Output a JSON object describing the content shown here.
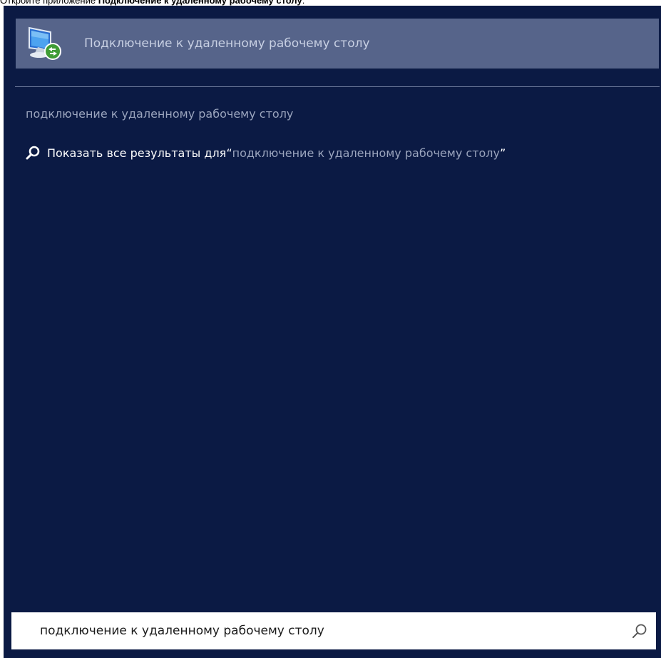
{
  "caption": {
    "prefix": "Откройте приложение ",
    "app_name": "Подключение к удаленному рабочему столу",
    "suffix": "."
  },
  "search_results": {
    "app_result": {
      "label": "Подключение к удаленному рабочему столу",
      "icon": "remote-desktop-icon"
    },
    "suggestion": "подключение к удаленному рабочему столу",
    "show_all": {
      "prefix": "Показать все результаты для ",
      "open_quote": "“",
      "query": "подключение к удаленному рабочему столу",
      "close_quote": "”",
      "icon": "search-icon"
    }
  },
  "search_box": {
    "value": "подключение к удаленному рабочему столу",
    "button_icon": "search-icon"
  },
  "colors": {
    "panel_bg": "#0b1a44",
    "highlight_bg": "#56648a",
    "muted_text": "#9aa4bd"
  }
}
